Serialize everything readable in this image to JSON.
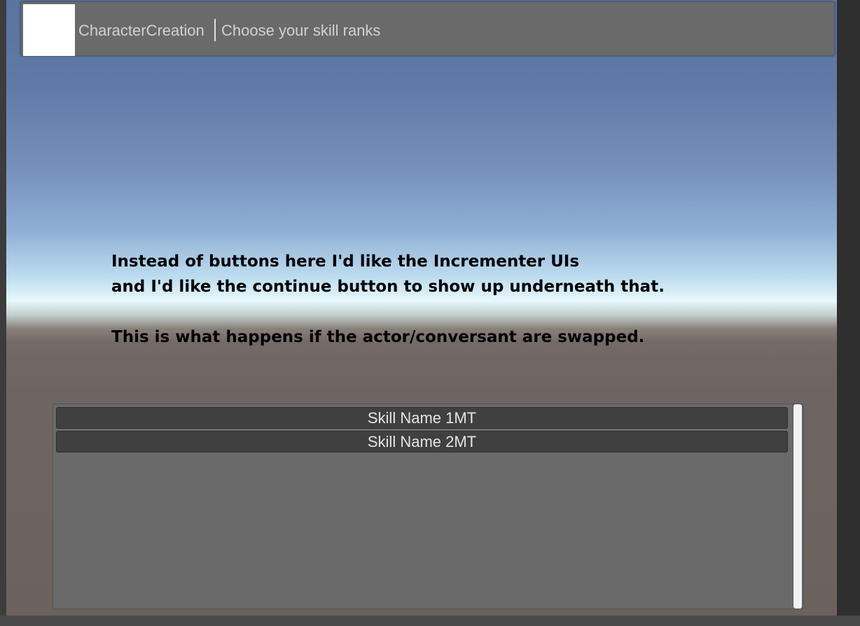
{
  "dialogue_header": {
    "speaker_name": "CharacterCreation",
    "subtitle": "Choose your skill ranks"
  },
  "annotation": {
    "lines": [
      "Instead of buttons here I'd like the Incrementer UIs",
      "and I'd like the continue button to show up underneath that.",
      "",
      "This is what happens if the actor/conversant are swapped."
    ]
  },
  "response_menu": {
    "buttons": [
      {
        "label": "Skill Name 1MT"
      },
      {
        "label": "Skill Name 2MT"
      }
    ],
    "scroll_position": 0
  },
  "colors": {
    "panel": "#6a6a6a",
    "button": "#404040",
    "text": "#d2d2d2",
    "annotation_text": "#000000"
  }
}
